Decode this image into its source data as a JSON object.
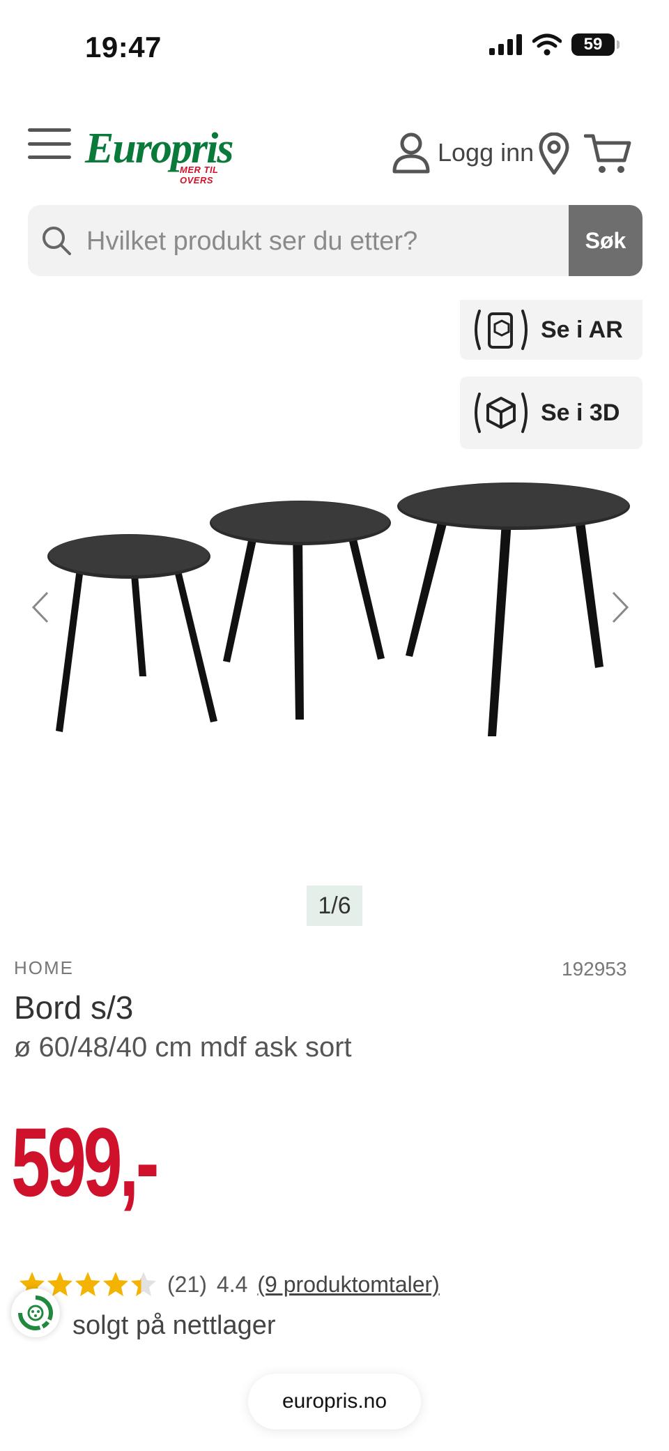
{
  "status_bar": {
    "time": "19:47",
    "battery": "59"
  },
  "header": {
    "logo_text": "Europris",
    "logo_tagline": "MER TIL OVERS",
    "login_label": "Logg inn",
    "icons": [
      "menu-icon",
      "user-icon",
      "location-pin-icon",
      "cart-icon"
    ]
  },
  "search": {
    "placeholder": "Hvilket produkt ser du etter?",
    "button_label": "Søk"
  },
  "viewer": {
    "ar_label": "Se i AR",
    "three_d_label": "Se i 3D",
    "image_counter": "1/6"
  },
  "product": {
    "brand": "HOME",
    "sku": "192953",
    "title": "Bord s/3",
    "subtitle": "ø 60/48/40 cm mdf ask sort",
    "price": "599,-",
    "rating_count": "(21)",
    "rating_average": "4.4",
    "rating_stars": 4.4,
    "reviews_link": "(9 produktomtaler)",
    "availability": "solgt på nettlager"
  },
  "browser": {
    "url": "europris.no"
  },
  "colors": {
    "brand_green": "#0a7a3b",
    "price_red": "#d0112b",
    "star": "#f5b301"
  }
}
